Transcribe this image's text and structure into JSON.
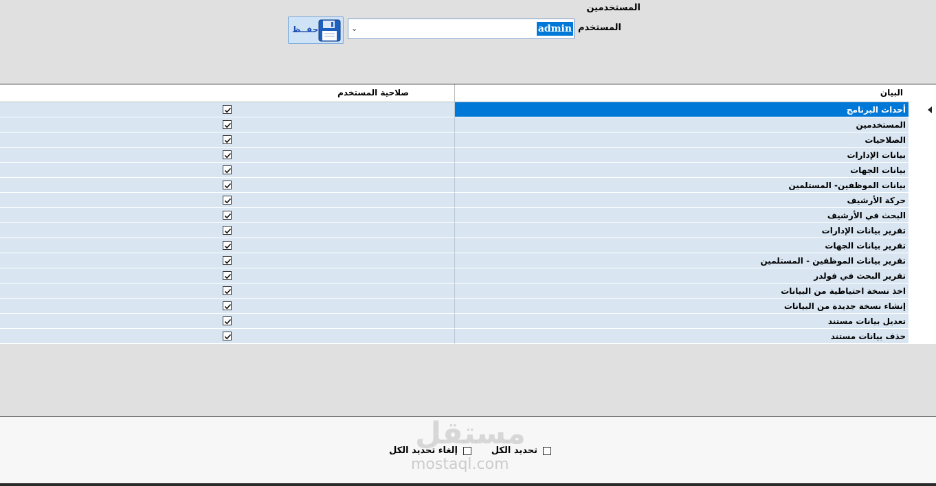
{
  "form": {
    "title": "المستخدمين",
    "user_label": "المستخدم",
    "user_value": "admin",
    "save_label": "حفــظ"
  },
  "grid": {
    "col_description": "البيان",
    "col_permission": "صلاحية المستخدم",
    "selected_row": 0,
    "rows": [
      {
        "label": "أحداث البرنامج",
        "checked": true
      },
      {
        "label": "المستخدمين",
        "checked": true
      },
      {
        "label": "الصلاحيات",
        "checked": true
      },
      {
        "label": "بيانات الإدارات",
        "checked": true
      },
      {
        "label": "بيانات الجهات",
        "checked": true
      },
      {
        "label": "بيانات الموظفين- المستلمين",
        "checked": true
      },
      {
        "label": "حركة الأرشيف",
        "checked": true
      },
      {
        "label": "البحث في الأرشيف",
        "checked": true
      },
      {
        "label": "تقرير بيانات الإدارات",
        "checked": true
      },
      {
        "label": "تقرير بيانات الجهات",
        "checked": true
      },
      {
        "label": "تقرير بيانات الموظفين - المستلمين",
        "checked": true
      },
      {
        "label": "تقرير البحث في فولدر",
        "checked": true
      },
      {
        "label": "اخذ نسخة احتياطية من البيانات",
        "checked": true
      },
      {
        "label": "إنشاء نسخة جديدة من البيانات",
        "checked": true
      },
      {
        "label": "تعديل بيانات مستند",
        "checked": true
      },
      {
        "label": "حذف بيانات مستند",
        "checked": true
      }
    ]
  },
  "options": {
    "select_all_label": "تحديد الكل",
    "deselect_all_label": "إلغاء تحديد الكل"
  },
  "watermark": {
    "arabic": "مستقل",
    "latin": "mostaql.com"
  },
  "icons": {
    "save": "floppy-disk-icon",
    "dropdown": "chevron-down-icon",
    "row_pointer": "row-pointer-icon",
    "checkbox": "checkbox-checked-icon"
  },
  "colors": {
    "selection": "#0078d7",
    "row_bg": "#d9e6f2",
    "save_button_bg": "#cfe3f7"
  }
}
